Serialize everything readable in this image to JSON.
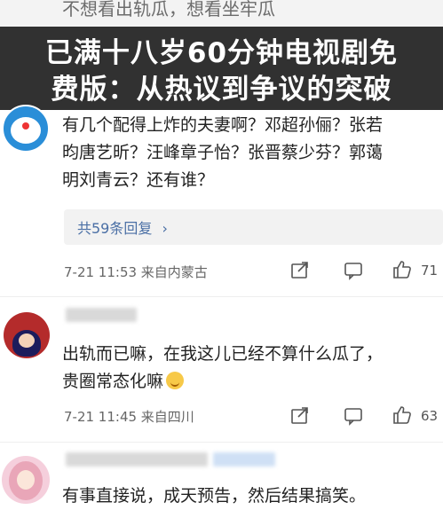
{
  "top_partial": {
    "text": "不想看出轨瓜，想看坐牢瓜"
  },
  "headline": {
    "line1": "已满十八岁60分钟电视剧免",
    "line2": "费版：从热议到争议的突破"
  },
  "comments": [
    {
      "lines": [
        "有几个配得上炸的夫妻啊？邓超孙俪？张若",
        "昀唐艺昕？汪峰章子怡？张晋蔡少芬？郭蔼",
        "明刘青云？还有谁？"
      ],
      "reply_label": "共59条回复",
      "reply_chevron": "›",
      "meta": "7-21 11:53 来自内蒙古",
      "likes": "71"
    },
    {
      "lines": [
        "出轨而已嘛，在我这儿已经不算什么瓜了，",
        "贵圈常态化嘛"
      ],
      "meta": "7-21 11:45 来自四川",
      "likes": "63"
    },
    {
      "lines": [
        "有事直接说，成天预告，然后结果搞笑。"
      ]
    }
  ],
  "icons": [
    "share-icon",
    "comment-icon",
    "like-icon"
  ],
  "colors": {
    "banner_bg": "#141414",
    "reply_link": "#4a6fa5",
    "meta_text": "#666666"
  }
}
